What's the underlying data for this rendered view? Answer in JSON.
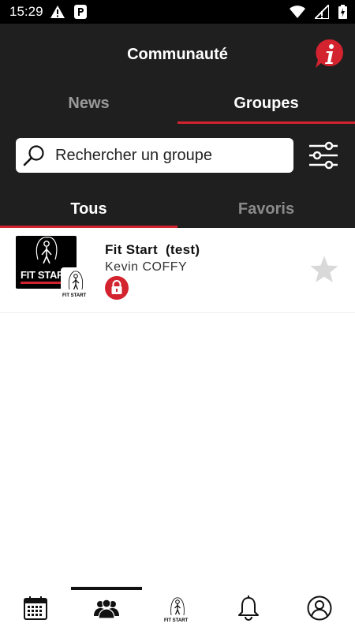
{
  "status_bar": {
    "time": "15:29",
    "left_icons": [
      "warning-icon",
      "parking-icon"
    ],
    "right_icons": [
      "wifi-icon",
      "signal-icon",
      "battery-icon"
    ]
  },
  "header": {
    "title": "Communauté",
    "top_tabs": [
      {
        "label": "News",
        "active": false
      },
      {
        "label": "Groupes",
        "active": true
      }
    ]
  },
  "search": {
    "placeholder": "Rechercher un groupe",
    "value": ""
  },
  "sub_tabs": [
    {
      "label": "Tous",
      "active": true
    },
    {
      "label": "Favoris",
      "active": false
    }
  ],
  "groups": [
    {
      "thumbnail_text": "FIT START",
      "badge_text": "FIT START",
      "name": "Fit Start  (test)",
      "owner": "Kevin COFFY",
      "locked": true,
      "favorite": false
    }
  ],
  "bottom_nav": {
    "items": [
      "calendar-icon",
      "community-icon",
      "fit-start-logo-icon",
      "bell-icon",
      "profile-icon"
    ],
    "active_index": 1,
    "logo_text": "FIT START"
  },
  "colors": {
    "header_bg": "#1f1f1f",
    "accent": "#d3232f",
    "inactive_tab": "#9a9a9a",
    "star_inactive": "#d9d9d9"
  }
}
